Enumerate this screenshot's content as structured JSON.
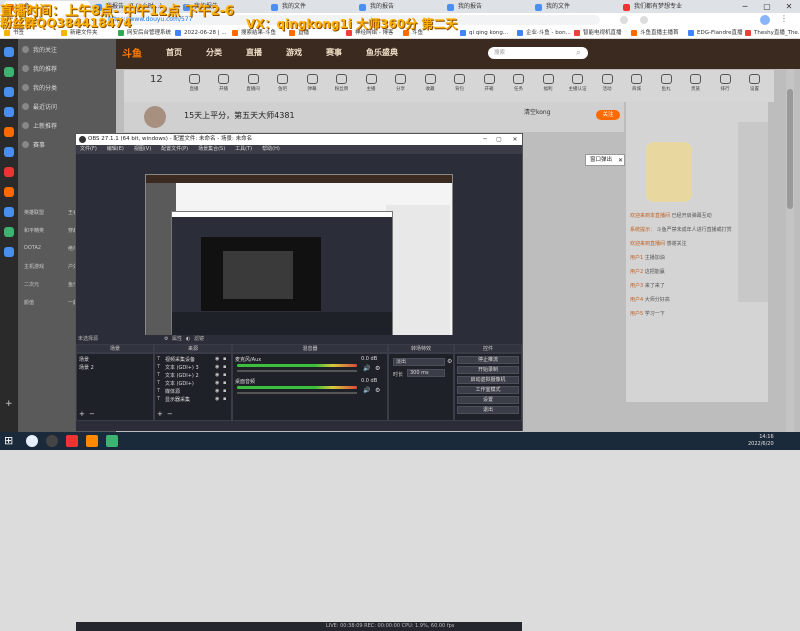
{
  "browser": {
    "tabs": [
      {
        "label": "斗鱼",
        "color": "#ff6a00"
      },
      {
        "label": "我报告 - 7 (1小时...)",
        "color": "#4a8ef0"
      },
      {
        "label": "我的报告",
        "color": "#4a8ef0"
      },
      {
        "label": "我的文件",
        "color": "#4a8ef0"
      },
      {
        "label": "我的报告",
        "color": "#4a8ef0"
      },
      {
        "label": "我的报告",
        "color": "#4a8ef0"
      },
      {
        "label": "我的文件",
        "color": "#4a8ef0"
      },
      {
        "label": "我们都有梦想专业",
        "color": "#e33"
      }
    ],
    "url": "https://www.douyu.com/577",
    "bookmarks": [
      {
        "label": "书签",
        "color": "#f4b400"
      },
      {
        "label": "新建文件夹",
        "color": "#f4b400"
      },
      {
        "label": "网安后台管理系统",
        "color": "#34a853"
      },
      {
        "label": "2022-06-28 | ...",
        "color": "#4285f4"
      },
      {
        "label": "搜索结果-斗鱼",
        "color": "#ff6a00"
      },
      {
        "label": "直播",
        "color": "#ff6a00"
      },
      {
        "label": "神经网络 - 博客",
        "color": "#ea4335"
      },
      {
        "label": "斗鱼",
        "color": "#ff6a00"
      },
      {
        "label": "qi qing kong...",
        "color": "#4285f4"
      },
      {
        "label": "企业·斗鱼 - bon...",
        "color": "#4285f4"
      },
      {
        "label": "智能电视机直播",
        "color": "#ea4335"
      },
      {
        "label": "斗鱼直播主播首",
        "color": "#ff6a00"
      },
      {
        "label": "EDG-Flandre直播",
        "color": "#4285f4"
      },
      {
        "label": "Theshy直播_The...",
        "color": "#ea4335"
      }
    ]
  },
  "overlay": {
    "line1": "直播时间：上午8点- 中午12点  下午2-6",
    "line2": "粉丝群QQ384418474",
    "line3": "VX：qingkong1i  大师360分 第二天"
  },
  "site": {
    "logo": "斗鱼",
    "nav": [
      "首页",
      "分类",
      "直播",
      "游戏",
      "赛事",
      "鱼乐盛典"
    ],
    "search_placeholder": "搜索",
    "sidebar": [
      "我的关注",
      "我的推荐",
      "我的分类",
      "最近访问",
      "上新推荐",
      "赛事"
    ],
    "sidegrid": [
      [
        "英雄联盟",
        "王者荣耀"
      ],
      [
        "和平精英",
        "穿越火线"
      ],
      [
        "DOTA2",
        "绝地求生"
      ],
      [
        "主机游戏",
        "户外"
      ],
      [
        "二次元",
        "鱼乐星天"
      ],
      [
        "颜值",
        "一起看"
      ]
    ],
    "icons": [
      "直播",
      "开播",
      "直播间",
      "鱼吧",
      "弹幕",
      "粉丝牌",
      "主播",
      "分享",
      "收藏",
      "背包",
      "开箱",
      "任务",
      "福利",
      "主播认证",
      "活动",
      "商城",
      "鱼丸",
      "贵族",
      "排行",
      "设置"
    ],
    "rank": "12",
    "stream_title": "15天上平分，第五天大师4381",
    "streamer_name": "清空kong",
    "follow_label": "关注",
    "chat": [
      {
        "user": "欢迎来到本直播间",
        "msg": "已经开启弹幕互动"
      },
      {
        "user": "系统提示：",
        "msg": "斗鱼严禁未成年人进行直播或打赏"
      },
      {
        "user": "欢迎来到直播间",
        "msg": "感谢关注"
      },
      {
        "user": "用户1",
        "msg": "主播加油"
      },
      {
        "user": "用户2",
        "msg": "这把能赢"
      },
      {
        "user": "用户3",
        "msg": "来了来了"
      },
      {
        "user": "用户4",
        "msg": "大师分好高"
      },
      {
        "user": "用户5",
        "msg": "学习一下"
      }
    ]
  },
  "obs": {
    "title": "OBS 27.1.1 (64 bit, windows) - 配置文件: 未命名 - 场景: 未命名",
    "menu": [
      "文件(F)",
      "编辑(E)",
      "视图(V)",
      "配置文件(P)",
      "场景集合(S)",
      "工具(T)",
      "帮助(H)"
    ],
    "popout": "窗口弹出",
    "no_source": "未选择源",
    "props": "属性",
    "filters": "滤镜",
    "docks": {
      "scenes": "场景",
      "sources": "来源",
      "mixer": "混音器",
      "transitions": "转场特效",
      "controls": "控件"
    },
    "scenes": [
      "场景",
      "场景 2"
    ],
    "sources": [
      "视频采集设备",
      "文本 (GDI+) 3",
      "文本 (GDI+) 2",
      "文本 (GDI+)",
      "媒体源",
      "显示器采集"
    ],
    "mixer": [
      {
        "name": "麦克风/Aux",
        "db": "0.0 dB"
      },
      {
        "name": "桌面音频",
        "db": "0.0 dB"
      }
    ],
    "transition": "淡出",
    "duration_label": "时长",
    "duration": "300 ms",
    "controls": [
      "停止推流",
      "开始录制",
      "启动虚拟摄像机",
      "工作室模式",
      "设置",
      "退出"
    ],
    "status": "LIVE: 00:38:09    REC: 00:00:00    CPU: 1.9%, 60.00 fps"
  },
  "taskbar": {
    "time": "14:16",
    "date": "2022/6/20"
  }
}
